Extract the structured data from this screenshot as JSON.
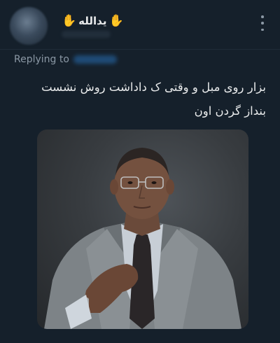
{
  "tweet": {
    "display_name": "یدالله",
    "name_emoji_left": "✋",
    "name_emoji_right": "✋",
    "replying_label": "Replying to",
    "text_line1": "بزار روی مبل و وقتی ک داداشت روش نشست",
    "text_line2": "بنداز گردن اون"
  },
  "icons": {
    "more": "more-vertical-icon",
    "emoji": "raised-hand-icon"
  },
  "colors": {
    "background": "#15202b",
    "text": "#e7e9ea",
    "secondary_text": "#8b98a5",
    "link": "#1d9bf0"
  }
}
